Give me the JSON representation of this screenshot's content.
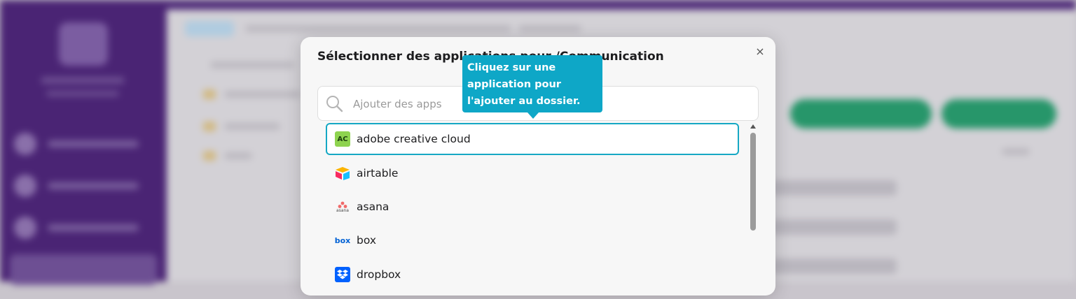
{
  "modal": {
    "title": "Sélectionner des applications pour /Communication",
    "close_label": "×",
    "search": {
      "placeholder": "Ajouter des apps",
      "value": ""
    },
    "apps": [
      {
        "label": "adobe creative cloud",
        "icon": "adobe-creative-cloud-icon",
        "badge": "AC",
        "selected": true
      },
      {
        "label": "airtable",
        "icon": "airtable-icon",
        "selected": false
      },
      {
        "label": "asana",
        "icon": "asana-icon",
        "badge": "asana",
        "selected": false
      },
      {
        "label": "box",
        "icon": "box-icon",
        "badge": "box",
        "selected": false
      },
      {
        "label": "dropbox",
        "icon": "dropbox-icon",
        "selected": false
      }
    ]
  },
  "tooltip": {
    "lines": [
      "Cliquez sur une",
      "application pour",
      "l'ajouter au dossier."
    ]
  },
  "colors": {
    "accent": "#0ea7c7",
    "selected_border": "#16a8c4",
    "sidebar": "#4a2474",
    "adobe_badge": "#8ed34f",
    "box_blue": "#0061d5",
    "dropbox_blue": "#0061fe",
    "asana_red": "#f06a6a"
  }
}
